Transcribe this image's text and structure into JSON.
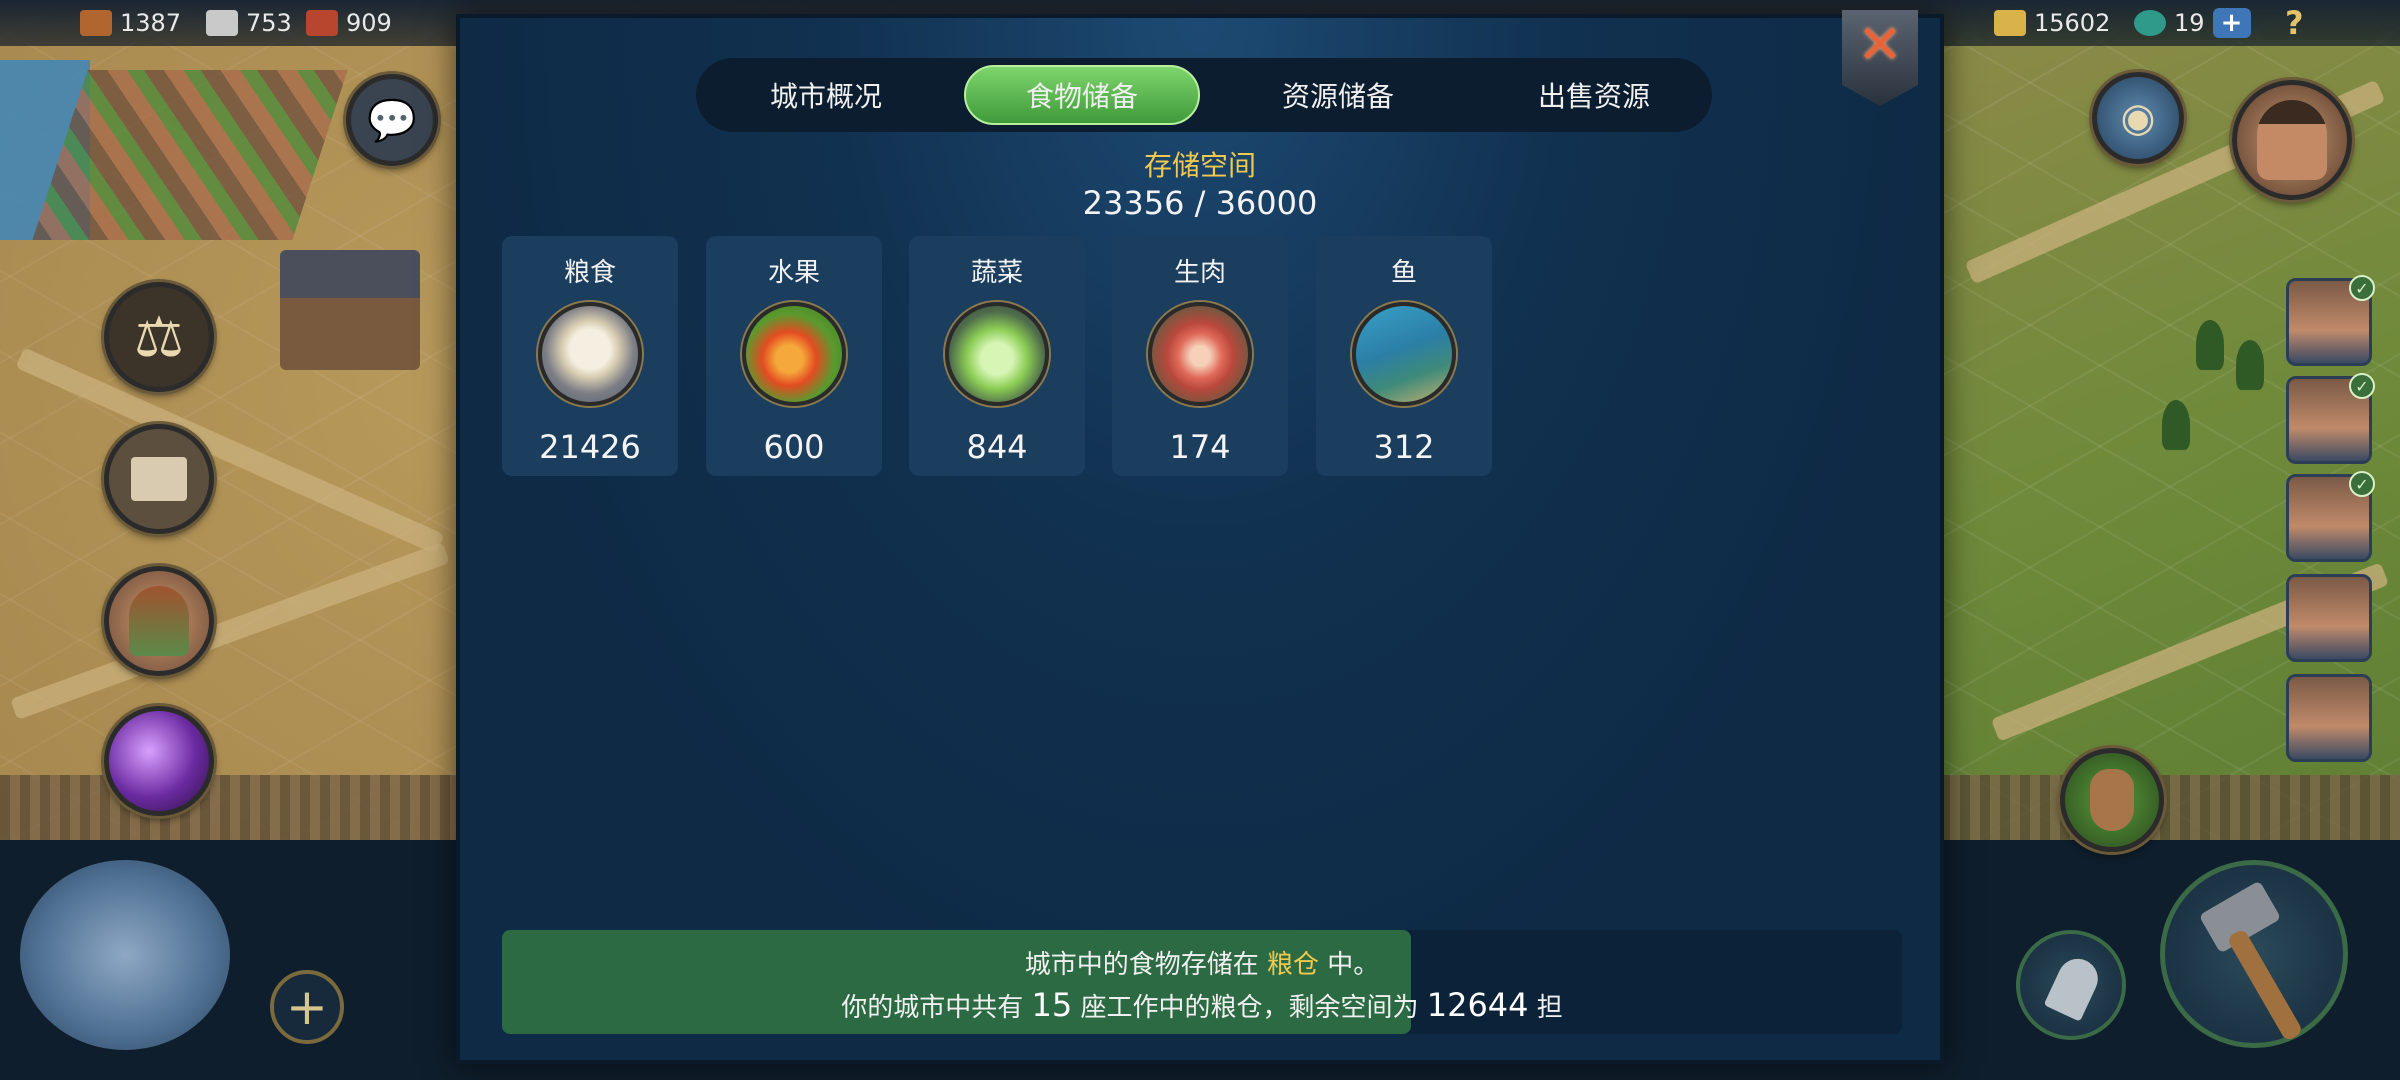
{
  "top_bar": {
    "resources_left": [
      {
        "icon": "wood-log-icon",
        "value": "1387",
        "color": "#b0662e"
      },
      {
        "icon": "stone-icon",
        "value": "753",
        "color": "#c9c9c9"
      },
      {
        "icon": "ore-icon",
        "value": "909",
        "color": "#b8452e"
      }
    ],
    "gold": {
      "icon": "gold-ingot-icon",
      "value": "15602"
    },
    "gems": {
      "icon": "gem-icon",
      "value": "19"
    },
    "plus_label": "+",
    "help_label": "?"
  },
  "dialog": {
    "tabs": [
      {
        "label": "城市概况",
        "active": false
      },
      {
        "label": "食物储备",
        "active": true
      },
      {
        "label": "资源储备",
        "active": false
      },
      {
        "label": "出售资源",
        "active": false
      }
    ],
    "close_label": "✕",
    "storage_title": "存储空间",
    "storage_value": "23356 / 36000",
    "storage_fill_fraction": 0.649,
    "foods": [
      {
        "name": "粮食",
        "icon": "grain-sack-icon",
        "amount": "21426"
      },
      {
        "name": "水果",
        "icon": "apple-icon",
        "amount": "600"
      },
      {
        "name": "蔬菜",
        "icon": "cabbage-icon",
        "amount": "844"
      },
      {
        "name": "生肉",
        "icon": "raw-meat-icon",
        "amount": "174"
      },
      {
        "name": "鱼",
        "icon": "fish-icon",
        "amount": "312"
      }
    ],
    "info": {
      "line1_prefix": "城市中的食物存储在 ",
      "line1_highlight": "粮仓",
      "line1_suffix": " 中。",
      "line2_prefix": "你的城市中共有 ",
      "line2_count": "15",
      "line2_middle": " 座工作中的粮仓，剩余空间为 ",
      "line2_space": "12644",
      "line2_unit": " 担"
    }
  },
  "side_buttons": {
    "left": [
      {
        "icon": "chat-bubble-icon"
      },
      {
        "icon": "scales-icon"
      },
      {
        "icon": "folder-icon"
      },
      {
        "icon": "advisor-portrait-icon"
      },
      {
        "icon": "potion-icon"
      }
    ],
    "right_portraits": [
      {
        "checked": true
      },
      {
        "checked": true
      },
      {
        "checked": true
      },
      {
        "checked": false
      },
      {
        "checked": false
      }
    ]
  },
  "bottom_controls": {
    "add_label": "+",
    "map_tool_icon": "map-compass-icon",
    "shovel_icon": "shovel-icon",
    "hammer_icon": "hammer-icon",
    "gourd_icon": "gourd-icon"
  }
}
